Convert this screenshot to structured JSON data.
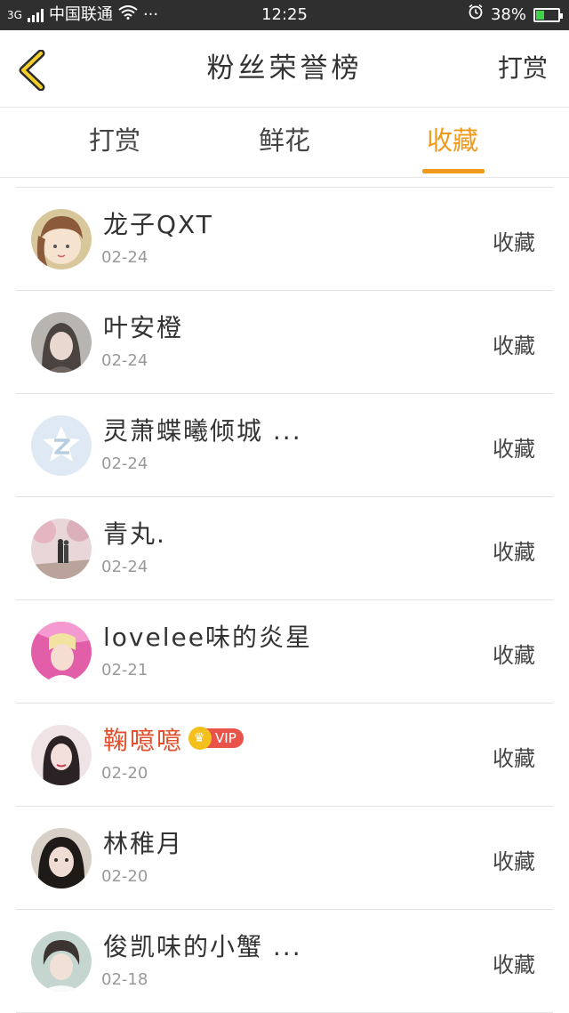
{
  "status_bar": {
    "network": "3G",
    "carrier": "中国联通",
    "dots": "···",
    "time": "12:25",
    "battery": "38%",
    "battery_level": 0.38
  },
  "navbar": {
    "title": "粉丝荣誉榜",
    "right_action": "打赏"
  },
  "tabs": [
    {
      "label": "打赏",
      "active": false
    },
    {
      "label": "鲜花",
      "active": false
    },
    {
      "label": "收藏",
      "active": true
    }
  ],
  "list": [
    {
      "name": "龙子QXT",
      "date": "02-24",
      "action": "收藏",
      "vip": false
    },
    {
      "name": "叶安橙",
      "date": "02-24",
      "action": "收藏",
      "vip": false
    },
    {
      "name": "灵萧蝶曦倾城 ...",
      "date": "02-24",
      "action": "收藏",
      "vip": false
    },
    {
      "name": "青丸.",
      "date": "02-24",
      "action": "收藏",
      "vip": false
    },
    {
      "name": "lovelee味的炎星",
      "date": "02-21",
      "action": "收藏",
      "vip": false
    },
    {
      "name": "鞠噫噫",
      "date": "02-20",
      "action": "收藏",
      "vip": true,
      "vip_label": "VIP"
    },
    {
      "name": "林稚月",
      "date": "02-20",
      "action": "收藏",
      "vip": false
    },
    {
      "name": "俊凯味的小蟹 ...",
      "date": "02-18",
      "action": "收藏",
      "vip": false
    }
  ],
  "colors": {
    "accent": "#f19a1a",
    "vip_name": "#e0502e",
    "status_bar": "#2f2f2f"
  }
}
